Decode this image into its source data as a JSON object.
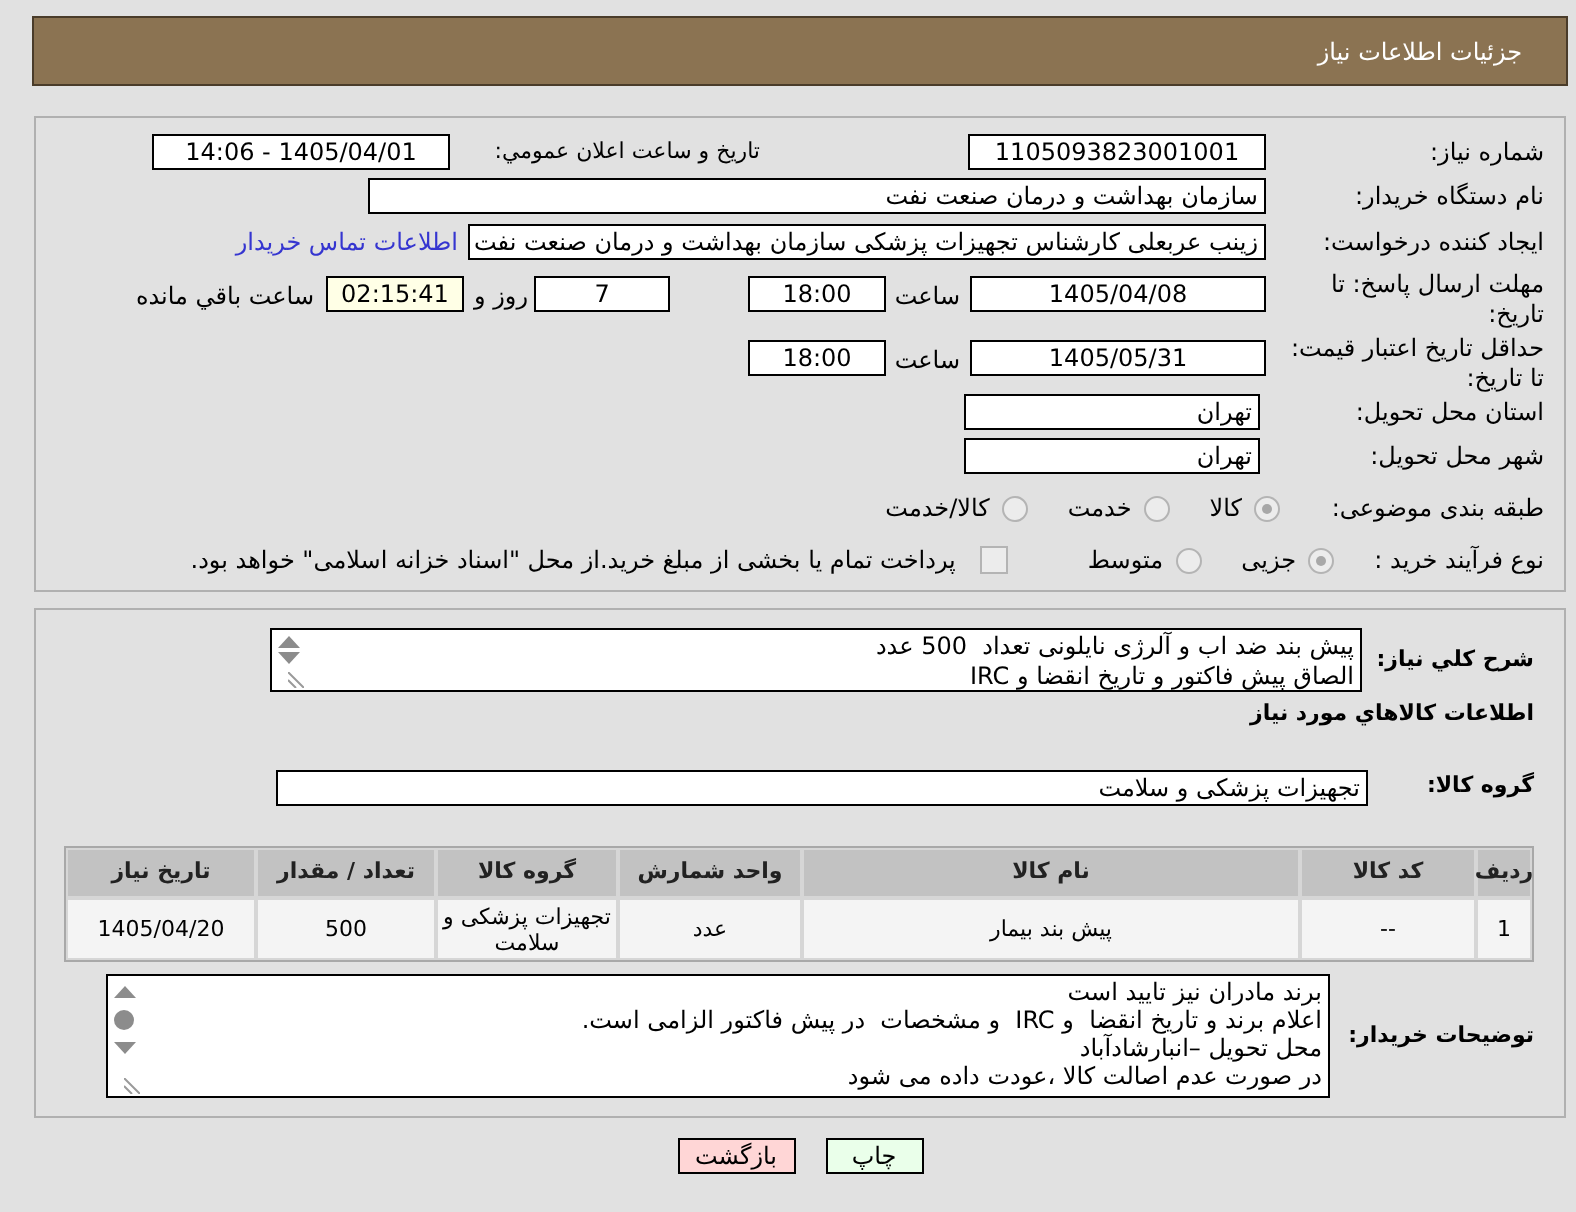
{
  "header": {
    "title": "جزئیات اطلاعات نیاز"
  },
  "details": {
    "need_number": {
      "label": "شماره نیاز:",
      "value": "1105093823001001"
    },
    "announcement": {
      "label": "تاریخ و ساعت اعلان عمومي:",
      "value": "1405/04/01 - 14:06"
    },
    "buyer_org": {
      "label": "نام دستگاه خریدار:",
      "value": "سازمان بهداشت و درمان صنعت نفت"
    },
    "requester": {
      "label": "ایجاد کننده درخواست:",
      "value": "زینب عربعلی کارشناس تجهیزات پزشکی سازمان بهداشت و درمان صنعت نفت",
      "link": "اطلاعات تماس خریدار"
    },
    "response_deadline": {
      "label": "مهلت ارسال پاسخ: تا تاریخ:",
      "date": "1405/04/08",
      "time_label": "ساعت",
      "time": "18:00",
      "days": "7",
      "days_label": "روز و",
      "remaining": "02:15:41",
      "remaining_label": "ساعت باقي مانده"
    },
    "price_validity": {
      "label": "حداقل تاریخ اعتبار قیمت: تا تاریخ:",
      "date": "1405/05/31",
      "time_label": "ساعت",
      "time": "18:00"
    },
    "province": {
      "label": "استان محل تحویل:",
      "value": "تهران"
    },
    "city": {
      "label": "شهر محل تحویل:",
      "value": "تهران"
    },
    "category": {
      "label": "طبقه بندی موضوعی:",
      "options": [
        {
          "label": "کالا",
          "selected": true
        },
        {
          "label": "خدمت",
          "selected": false
        },
        {
          "label": "کالا/خدمت",
          "selected": false
        }
      ]
    },
    "purchase_process": {
      "label": "نوع فرآیند خرید :",
      "options": [
        {
          "label": "جزیی",
          "selected": true
        },
        {
          "label": "متوسط",
          "selected": false
        }
      ],
      "treasury": {
        "label": "پرداخت تمام یا بخشی از مبلغ خرید.از محل \"اسناد خزانه اسلامی\" خواهد بود.",
        "checked": false
      }
    }
  },
  "need": {
    "description": {
      "label": "شرح کلي نیاز:",
      "lines": [
        "پیش بند ضد اب و آلرژی نایلونی تعداد  500 عدد",
        "الصاق پیش فاکتور و تاریخ انقضا و IRC"
      ]
    },
    "goods_title": "اطلاعات کالاهاي مورد نیاز",
    "goods_group": {
      "label": "گروه کالا:",
      "value": "تجهیزات پزشکی و سلامت"
    },
    "table": {
      "columns": [
        "ردیف",
        "کد کالا",
        "نام کالا",
        "واحد شمارش",
        "گروه کالا",
        "تعداد / مقدار",
        "تاریخ نیاز"
      ],
      "rows": [
        [
          "1",
          "--",
          "پیش بند بیمار",
          "عدد",
          "تجهیزات پزشکی و سلامت",
          "500",
          "1405/04/20"
        ]
      ]
    },
    "buyer_notes": {
      "label": "توضیحات خریدار:",
      "lines": [
        "برند مادران نیز تایید است",
        "اعلام برند و تاریخ انقضا  و IRC  و مشخصات  در پیش فاکتور الزامی است.",
        "محل تحویل –انبارشادآباد",
        "در صورت عدم اصالت کالا ،عودت داده می شود"
      ]
    }
  },
  "buttons": [
    {
      "label": "چاپ",
      "kind": "print"
    },
    {
      "label": "بازگشت",
      "kind": "back"
    }
  ]
}
